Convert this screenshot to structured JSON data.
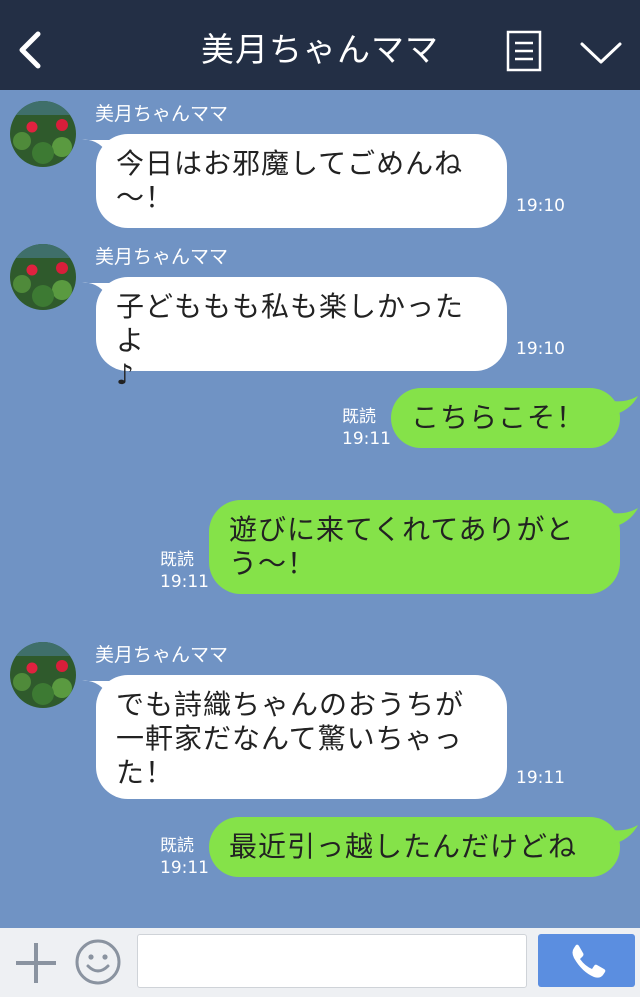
{
  "header": {
    "title": "美月ちゃんママ",
    "back_icon": "chevron-left-icon",
    "menu_icon": "menu-icon",
    "collapse_icon": "chevron-down-icon"
  },
  "messages": [
    {
      "sender": "美月ちゃんママ",
      "text": "今日はお邪魔してごめんね\n〜！",
      "time": "19:10"
    },
    {
      "sender": "美月ちゃんママ",
      "text": "子どももも私も楽しかったよ\n♪",
      "time": "19:10"
    },
    {
      "read": "既読",
      "text": "こちらこそ！",
      "time": "19:11"
    },
    {
      "read": "既読",
      "text": "遊びに来てくれてありがと\nう〜！",
      "time": "19:11"
    },
    {
      "sender": "美月ちゃんママ",
      "text": "でも詩織ちゃんのおうちが\n一軒家だなんて驚いちゃっ\nた！",
      "time": "19:11"
    },
    {
      "read": "既読",
      "text": "最近引っ越したんだけどね",
      "time": "19:11"
    }
  ],
  "bottom_bar": {
    "plus_icon": "plus-icon",
    "emoji_icon": "smiley-icon",
    "call_icon": "phone-icon",
    "input_value": ""
  },
  "colors": {
    "header_bg": "#232F45",
    "chat_bg": "#7093C4",
    "incoming_bubble": "#FFFFFF",
    "outgoing_bubble": "#85E249",
    "call_button": "#5B8EE0"
  }
}
